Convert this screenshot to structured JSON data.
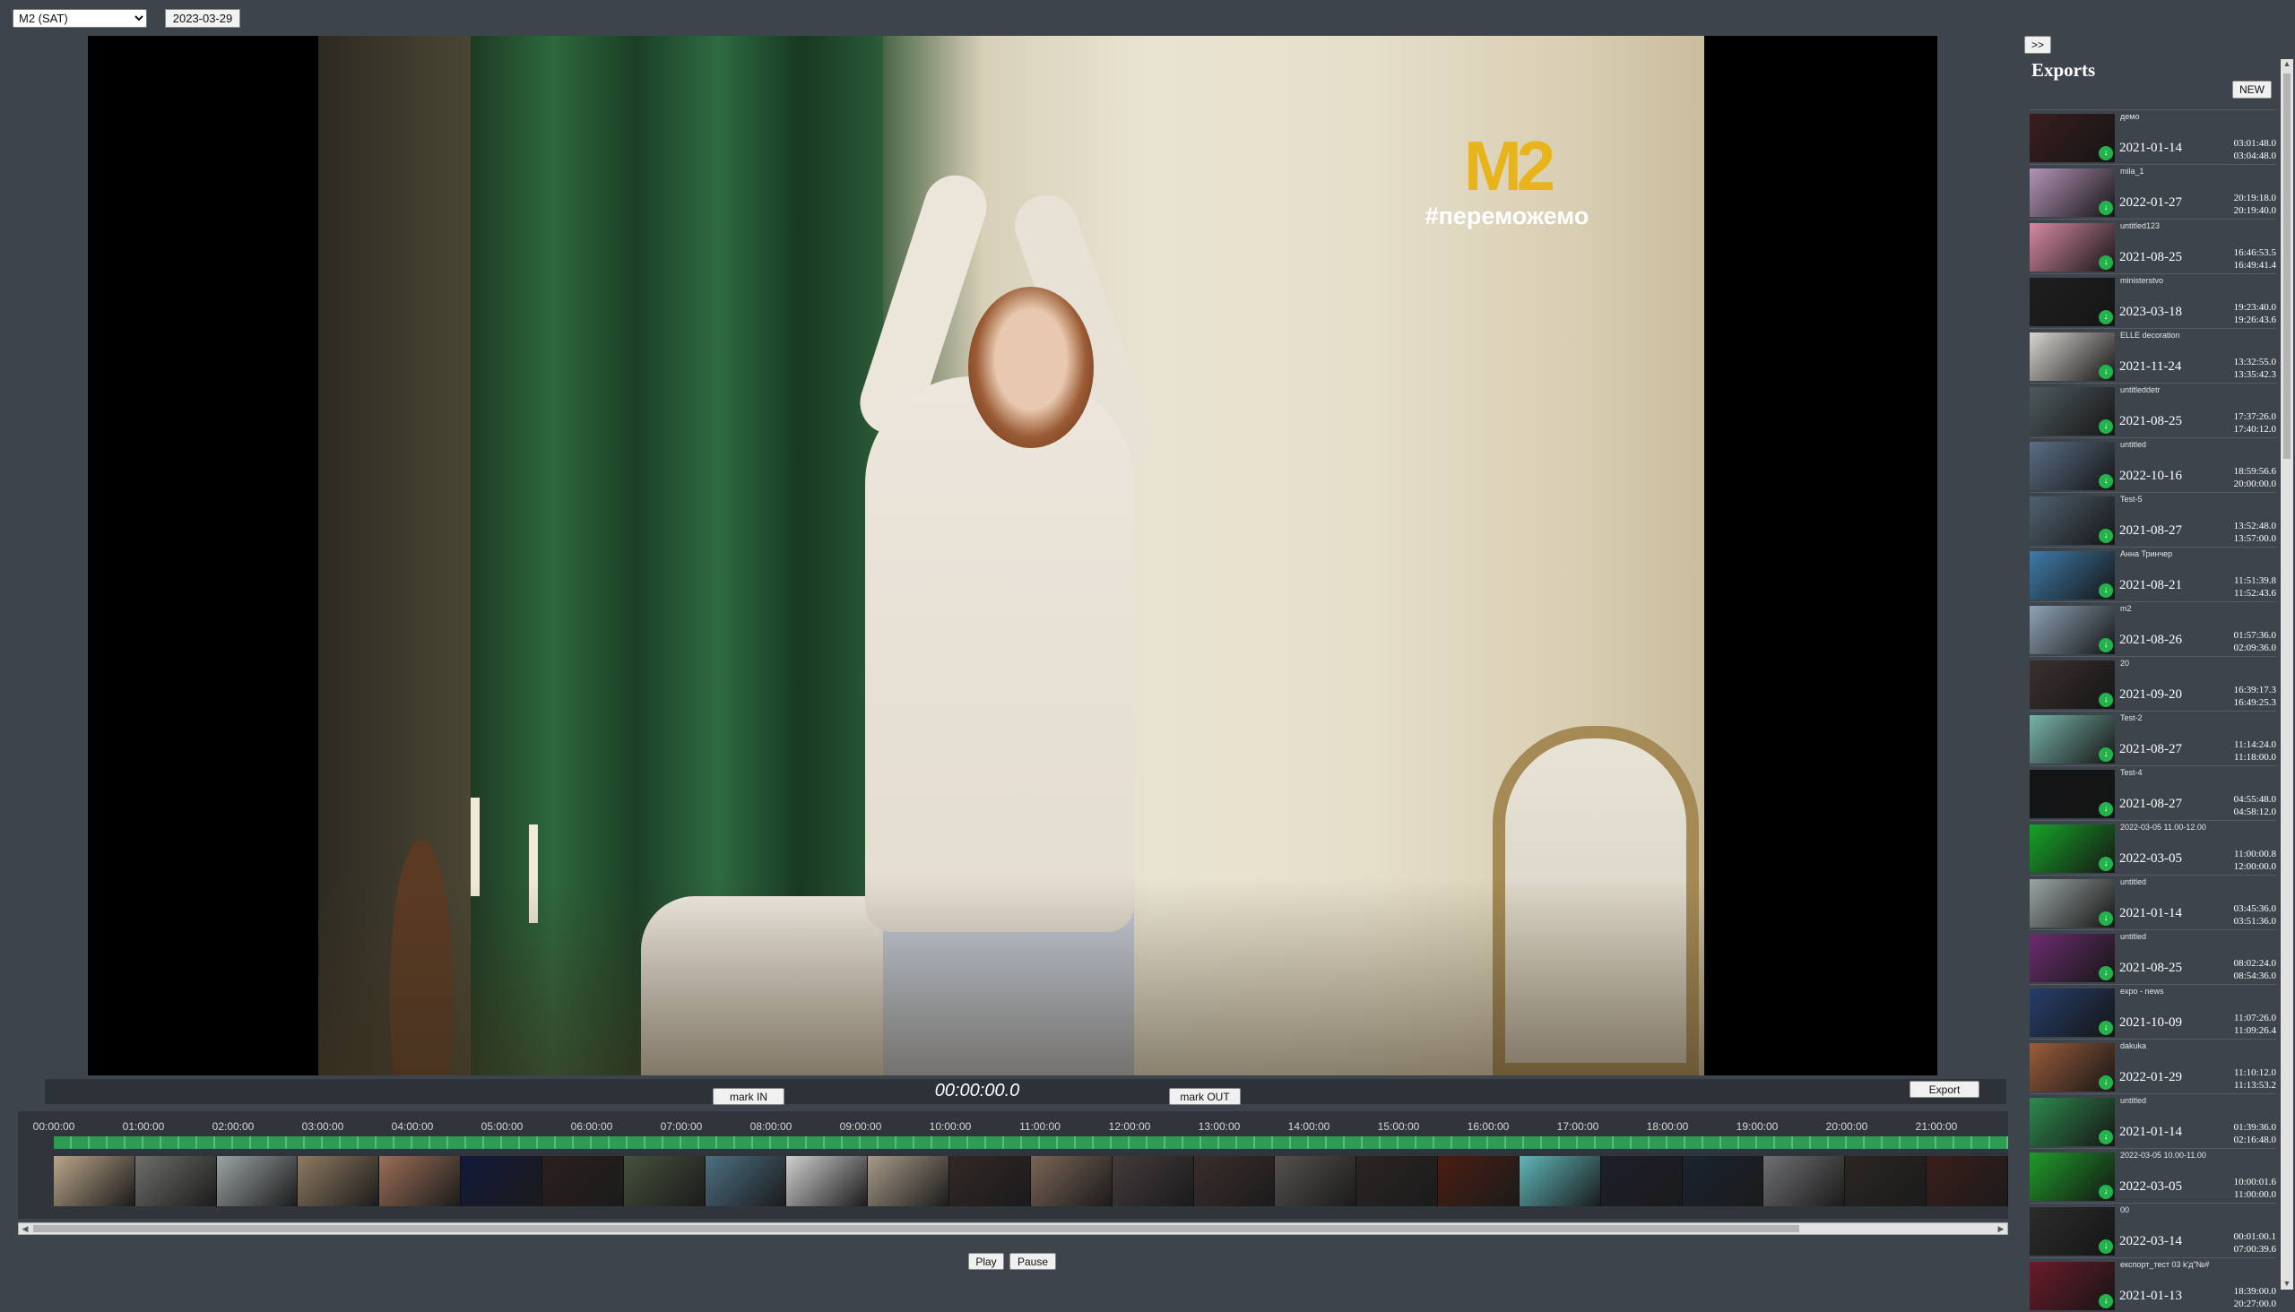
{
  "header": {
    "channel_select": "M2 (SAT)",
    "date": "2023-03-29"
  },
  "video": {
    "watermark_logo": "M2",
    "watermark_text": "#переможемо"
  },
  "controls": {
    "mark_in": "mark IN",
    "timecode": "00:00:00.0",
    "mark_out": "mark OUT",
    "export": "Export",
    "play": "Play",
    "pause": "Pause"
  },
  "timeline": {
    "ticks": [
      "00:00:00",
      "01:00:00",
      "02:00:00",
      "03:00:00",
      "04:00:00",
      "05:00:00",
      "06:00:00",
      "07:00:00",
      "08:00:00",
      "09:00:00",
      "10:00:00",
      "11:00:00",
      "12:00:00",
      "13:00:00",
      "14:00:00",
      "15:00:00",
      "16:00:00",
      "17:00:00",
      "18:00:00",
      "19:00:00",
      "20:00:00",
      "21:00:00"
    ],
    "thumb_colors": [
      "#b9a489",
      "#6d6e6a",
      "#9aa3a4",
      "#8f7a62",
      "#9b6e57",
      "#121a3a",
      "#2b1f1f",
      "#46523c",
      "#4c6f83",
      "#cfcfcf",
      "#a79a88",
      "#312826",
      "#7a6556",
      "#433b3c",
      "#3a2e2c",
      "#55514e",
      "#2b2424",
      "#4a1d12",
      "#5fb5b8",
      "#1d1f2b",
      "#1a2330",
      "#6e6f72",
      "#2a2622",
      "#3b1e1a"
    ]
  },
  "exports": {
    "toggle": ">>",
    "title": "Exports",
    "new_button": "NEW",
    "items": [
      {
        "name": "демо",
        "date": "2021-01-14",
        "start": "03:01:48.0",
        "end": "03:04:48.0",
        "color": "#3a1d1d"
      },
      {
        "name": "mila_1",
        "date": "2022-01-27",
        "start": "20:19:18.0",
        "end": "20:19:40.0",
        "color": "#b493b8"
      },
      {
        "name": "untitled123",
        "date": "2021-08-25",
        "start": "16:46:53.5",
        "end": "16:49:41.4",
        "color": "#d789a4"
      },
      {
        "name": "ministerstvo",
        "date": "2023-03-18",
        "start": "19:23:40.0",
        "end": "19:26:43.6",
        "color": "#1f1f1f"
      },
      {
        "name": "ELLE decoration",
        "date": "2021-11-24",
        "start": "13:32:55.0",
        "end": "13:35:42.3",
        "color": "#d8d5d0"
      },
      {
        "name": "untitleddetr",
        "date": "2021-08-25",
        "start": "17:37:26.0",
        "end": "17:40:12.0",
        "color": "#4f5a5e"
      },
      {
        "name": "untitled",
        "date": "2022-10-16",
        "start": "18:59:56.6",
        "end": "20:00:00.0",
        "color": "#5a6e86"
      },
      {
        "name": "Test-5",
        "date": "2021-08-27",
        "start": "13:52:48.0",
        "end": "13:57:00.0",
        "color": "#4f6270"
      },
      {
        "name": "Анна Тринчер",
        "date": "2021-08-21",
        "start": "11:51:39.8",
        "end": "11:52:43.6",
        "color": "#3f7aa8"
      },
      {
        "name": "m2",
        "date": "2021-08-26",
        "start": "01:57:36.0",
        "end": "02:09:36.0",
        "color": "#8fa3b6"
      },
      {
        "name": "20",
        "date": "2021-09-20",
        "start": "16:39:17.3",
        "end": "16:49:25.3",
        "color": "#3b3030"
      },
      {
        "name": "Test-2",
        "date": "2021-08-27",
        "start": "11:14:24.0",
        "end": "11:18:00.0",
        "color": "#78b3a8"
      },
      {
        "name": "Test-4",
        "date": "2021-08-27",
        "start": "04:55:48.0",
        "end": "04:58:12.0",
        "color": "#121416"
      },
      {
        "name": "2022-03-05 11.00-12.00",
        "date": "2022-03-05",
        "start": "11:00:00.8",
        "end": "12:00:00.0",
        "color": "#17a328"
      },
      {
        "name": "untitled",
        "date": "2021-01-14",
        "start": "03:45:36.0",
        "end": "03:51:36.0",
        "color": "#9aa6a4"
      },
      {
        "name": "untitled",
        "date": "2021-08-25",
        "start": "08:02:24.0",
        "end": "08:54:36.0",
        "color": "#6b2d6e"
      },
      {
        "name": "expo - news",
        "date": "2021-10-09",
        "start": "11:07:26.0",
        "end": "11:09:26.4",
        "color": "#263e6b"
      },
      {
        "name": "dakuka",
        "date": "2022-01-29",
        "start": "11:10:12.0",
        "end": "11:13:53.2",
        "color": "#9b5d3c"
      },
      {
        "name": "untitled",
        "date": "2021-01-14",
        "start": "01:39:36.0",
        "end": "02:16:48.0",
        "color": "#2f8a4e"
      },
      {
        "name": "2022-03-05 10.00-11.00",
        "date": "2022-03-05",
        "start": "10:00:01.6",
        "end": "11:00:00.0",
        "color": "#1f9b2a"
      },
      {
        "name": "00",
        "date": "2022-03-14",
        "start": "00:01:00.1",
        "end": "07:00:39.6",
        "color": "#2c2c2c"
      },
      {
        "name": "експорт_тест 03 k'д\"№#",
        "date": "2021-01-13",
        "start": "18:39:00.0",
        "end": "20:27:00.0",
        "color": "#6b1b2a"
      }
    ]
  }
}
